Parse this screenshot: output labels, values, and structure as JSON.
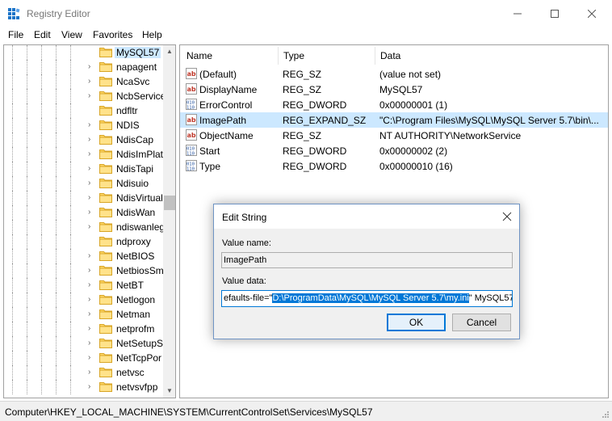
{
  "window": {
    "title": "Registry Editor",
    "accent_color": "#0078d7"
  },
  "menu": [
    "File",
    "Edit",
    "View",
    "Favorites",
    "Help"
  ],
  "tree": {
    "items": [
      {
        "label": "MySQL57",
        "selected": true,
        "expandable": false
      },
      {
        "label": "napagent",
        "expandable": true
      },
      {
        "label": "NcaSvc",
        "expandable": true
      },
      {
        "label": "NcbService",
        "expandable": true
      },
      {
        "label": "ndfltr",
        "expandable": false
      },
      {
        "label": "NDIS",
        "expandable": true
      },
      {
        "label": "NdisCap",
        "expandable": true
      },
      {
        "label": "NdisImPlat",
        "expandable": true
      },
      {
        "label": "NdisTapi",
        "expandable": true
      },
      {
        "label": "Ndisuio",
        "expandable": true
      },
      {
        "label": "NdisVirtual",
        "expandable": true
      },
      {
        "label": "NdisWan",
        "expandable": true
      },
      {
        "label": "ndiswanleg",
        "expandable": true
      },
      {
        "label": "ndproxy",
        "expandable": false
      },
      {
        "label": "NetBIOS",
        "expandable": true
      },
      {
        "label": "NetbiosSm",
        "expandable": true
      },
      {
        "label": "NetBT",
        "expandable": true
      },
      {
        "label": "Netlogon",
        "expandable": true
      },
      {
        "label": "Netman",
        "expandable": true
      },
      {
        "label": "netprofm",
        "expandable": true
      },
      {
        "label": "NetSetupSv",
        "expandable": true
      },
      {
        "label": "NetTcpPor",
        "expandable": true
      },
      {
        "label": "netvsc",
        "expandable": true
      },
      {
        "label": "netvsvfpp",
        "expandable": true
      }
    ]
  },
  "list": {
    "headers": {
      "name": "Name",
      "type": "Type",
      "data": "Data"
    },
    "rows": [
      {
        "name": "(Default)",
        "type": "REG_SZ",
        "data": "(value not set)",
        "icon": "string-value-icon"
      },
      {
        "name": "DisplayName",
        "type": "REG_SZ",
        "data": "MySQL57",
        "icon": "string-value-icon"
      },
      {
        "name": "ErrorControl",
        "type": "REG_DWORD",
        "data": "0x00000001 (1)",
        "icon": "binary-value-icon"
      },
      {
        "name": "ImagePath",
        "type": "REG_EXPAND_SZ",
        "data": "\"C:\\Program Files\\MySQL\\MySQL Server 5.7\\bin\\...",
        "icon": "string-value-icon",
        "selected": true
      },
      {
        "name": "ObjectName",
        "type": "REG_SZ",
        "data": "NT AUTHORITY\\NetworkService",
        "icon": "string-value-icon"
      },
      {
        "name": "Start",
        "type": "REG_DWORD",
        "data": "0x00000002 (2)",
        "icon": "binary-value-icon"
      },
      {
        "name": "Type",
        "type": "REG_DWORD",
        "data": "0x00000010 (16)",
        "icon": "binary-value-icon"
      }
    ]
  },
  "status": {
    "path": "Computer\\HKEY_LOCAL_MACHINE\\SYSTEM\\CurrentControlSet\\Services\\MySQL57"
  },
  "dialog": {
    "title": "Edit String",
    "value_name_label": "Value name:",
    "value_name": "ImagePath",
    "value_data_label": "Value data:",
    "value_data_before": "efaults-file=\"",
    "value_data_selected": "D:\\ProgramData\\MySQL\\MySQL Server 5.7\\my.ini",
    "value_data_after": "\" MySQL57",
    "ok_label": "OK",
    "cancel_label": "Cancel"
  }
}
